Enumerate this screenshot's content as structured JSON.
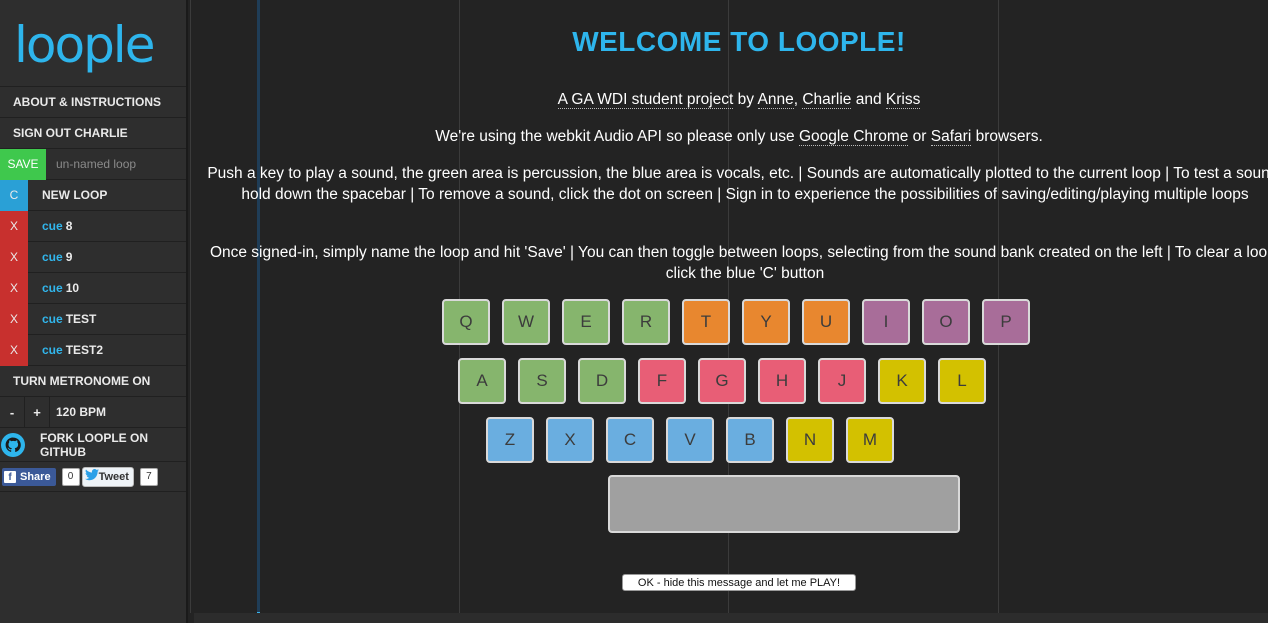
{
  "brand": {
    "logo_text": "loople",
    "logo_color": "#2eb5ec"
  },
  "sidebar": {
    "about_label": "ABOUT & INSTRUCTIONS",
    "signout_label": "SIGN OUT CHARLIE",
    "save_label": "SAVE",
    "loop_name_placeholder": "un-named loop",
    "clear_label": "C",
    "new_loop_label": "NEW LOOP",
    "cues": [
      {
        "delete_label": "X",
        "cue_word": "cue",
        "name": "8"
      },
      {
        "delete_label": "X",
        "cue_word": "cue",
        "name": "9"
      },
      {
        "delete_label": "X",
        "cue_word": "cue",
        "name": "10"
      },
      {
        "delete_label": "X",
        "cue_word": "cue",
        "name": "TEST"
      },
      {
        "delete_label": "X",
        "cue_word": "cue",
        "name": "TEST2"
      }
    ],
    "metronome_label": "TURN METRONOME ON",
    "minus_label": "-",
    "plus_label": "+",
    "bpm_label": "120 BPM",
    "github_label": "FORK LOOPLE ON GITHUB",
    "share_label": "Share",
    "share_count": "0",
    "tweet_label": "Tweet",
    "tweet_count": "7"
  },
  "welcome": {
    "title": "WELCOME TO LOOPLE!",
    "line1_a": "A GA WDI student project",
    "line1_b": " by ",
    "line1_c": "Anne",
    "line1_d": ", ",
    "line1_e": "Charlie",
    "line1_f": " and ",
    "line1_g": "Kriss",
    "line2_a": "We're using the webkit Audio API so please only use ",
    "line2_b": "Google Chrome",
    "line2_c": " or ",
    "line2_d": "Safari",
    "line2_e": " browsers.",
    "para3": "Push a key to play a sound, the green area is percussion, the blue area is vocals, etc. | Sounds are automatically plotted to the current loop | To test a sound, hold down the spacebar | To remove a sound, click the dot on screen | Sign in to experience the possibilities of saving/editing/playing multiple loops",
    "para4": "Once signed-in, simply name the loop and hit 'Save' | You can then toggle between loops, selecting from the sound bank created on the left | To clear a loop, click the blue 'C' button",
    "ok_label": "OK - hide this message and let me PLAY!"
  },
  "keyboard": {
    "colors": {
      "green": "#86b56d",
      "orange": "#e8872f",
      "purple": "#a86d99",
      "pink": "#e85e76",
      "yellow": "#d3c100",
      "blue": "#6aaee0"
    },
    "rows": [
      [
        {
          "k": "Q",
          "c": "green"
        },
        {
          "k": "W",
          "c": "green"
        },
        {
          "k": "E",
          "c": "green"
        },
        {
          "k": "R",
          "c": "green"
        },
        {
          "k": "T",
          "c": "orange"
        },
        {
          "k": "Y",
          "c": "orange"
        },
        {
          "k": "U",
          "c": "orange"
        },
        {
          "k": "I",
          "c": "purple"
        },
        {
          "k": "O",
          "c": "purple"
        },
        {
          "k": "P",
          "c": "purple"
        }
      ],
      [
        {
          "k": "A",
          "c": "green"
        },
        {
          "k": "S",
          "c": "green"
        },
        {
          "k": "D",
          "c": "green"
        },
        {
          "k": "F",
          "c": "pink"
        },
        {
          "k": "G",
          "c": "pink"
        },
        {
          "k": "H",
          "c": "pink"
        },
        {
          "k": "J",
          "c": "pink"
        },
        {
          "k": "K",
          "c": "yellow"
        },
        {
          "k": "L",
          "c": "yellow"
        }
      ],
      [
        {
          "k": "Z",
          "c": "blue"
        },
        {
          "k": "X",
          "c": "blue"
        },
        {
          "k": "C",
          "c": "blue"
        },
        {
          "k": "V",
          "c": "blue"
        },
        {
          "k": "B",
          "c": "blue"
        },
        {
          "k": "N",
          "c": "yellow"
        },
        {
          "k": "M",
          "c": "yellow"
        }
      ]
    ]
  }
}
